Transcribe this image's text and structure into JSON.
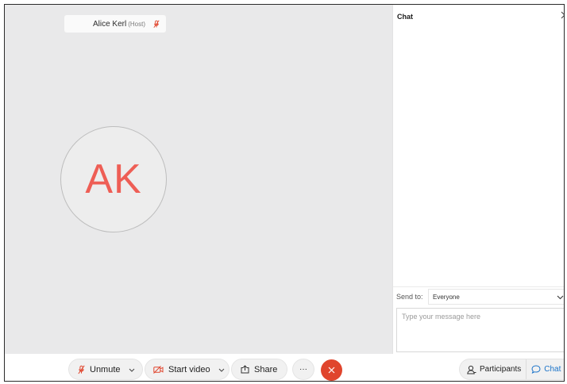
{
  "participant": {
    "name": "Alice Kerl",
    "role": "(Host)",
    "initials": "AK",
    "muted_icon": "mic-off-icon"
  },
  "chat_panel": {
    "title": "Chat",
    "close_icon": "chevron-right-icon",
    "send_to_label": "Send to:",
    "send_to_value": "Everyone",
    "message_placeholder": "Type your message here"
  },
  "toolbar": {
    "unmute_label": "Unmute",
    "start_video_label": "Start video",
    "share_label": "Share",
    "more_label": "···",
    "end_icon": "close-icon",
    "participants_label": "Participants",
    "chat_label": "Chat"
  },
  "colors": {
    "accent_red": "#e0452d",
    "initials_color": "#ee5e55",
    "chat_blue": "#1a73c9",
    "stage_bg": "#e9e9ea"
  }
}
